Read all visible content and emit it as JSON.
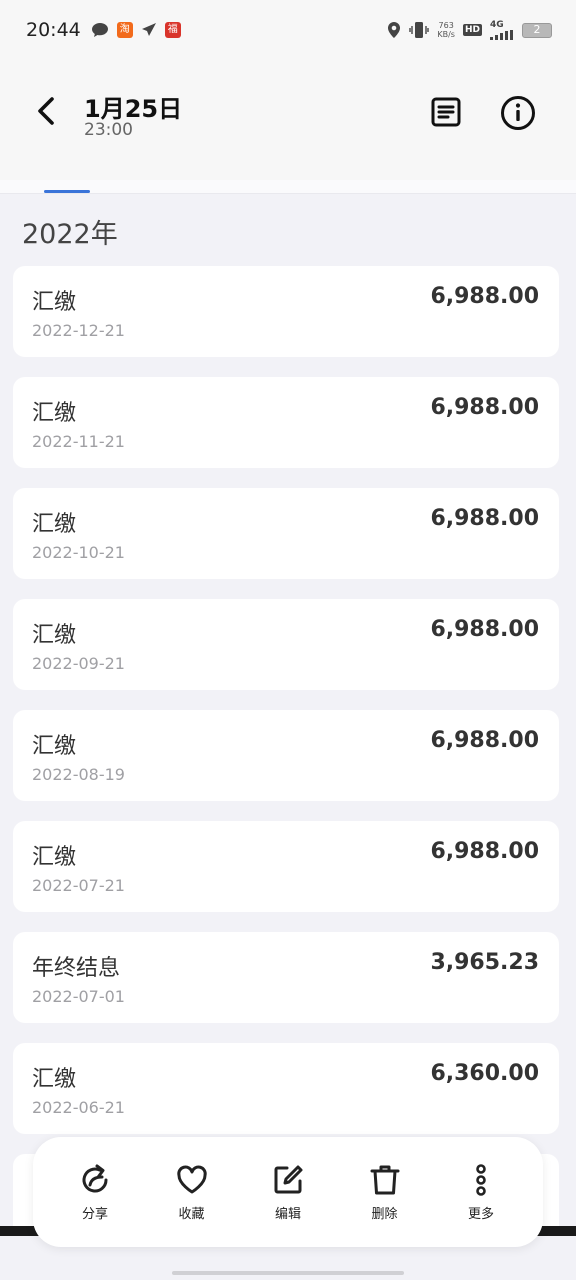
{
  "status_bar": {
    "time": "20:44",
    "speed_value": "763",
    "speed_unit": "KB/s",
    "hd": "HD",
    "network": "4G",
    "battery": "2",
    "app_badges": [
      "淘",
      "福"
    ]
  },
  "header": {
    "date": "1月25日",
    "time": "23:00"
  },
  "year_heading": "2022年",
  "records": [
    {
      "name": "汇缴",
      "date": "2022-12-21",
      "amount": "6,988.00"
    },
    {
      "name": "汇缴",
      "date": "2022-11-21",
      "amount": "6,988.00"
    },
    {
      "name": "汇缴",
      "date": "2022-10-21",
      "amount": "6,988.00"
    },
    {
      "name": "汇缴",
      "date": "2022-09-21",
      "amount": "6,988.00"
    },
    {
      "name": "汇缴",
      "date": "2022-08-19",
      "amount": "6,988.00"
    },
    {
      "name": "汇缴",
      "date": "2022-07-21",
      "amount": "6,988.00"
    },
    {
      "name": "年终结息",
      "date": "2022-07-01",
      "amount": "3,965.23"
    },
    {
      "name": "汇缴",
      "date": "2022-06-21",
      "amount": "6,360.00"
    }
  ],
  "actions": [
    {
      "label": "分享",
      "icon": "share-icon"
    },
    {
      "label": "收藏",
      "icon": "heart-icon"
    },
    {
      "label": "编辑",
      "icon": "edit-icon"
    },
    {
      "label": "删除",
      "icon": "trash-icon"
    },
    {
      "label": "更多",
      "icon": "more-icon"
    }
  ],
  "colors": {
    "accent": "#3a74d9",
    "background": "#f2f2f7",
    "card": "#ffffff"
  }
}
